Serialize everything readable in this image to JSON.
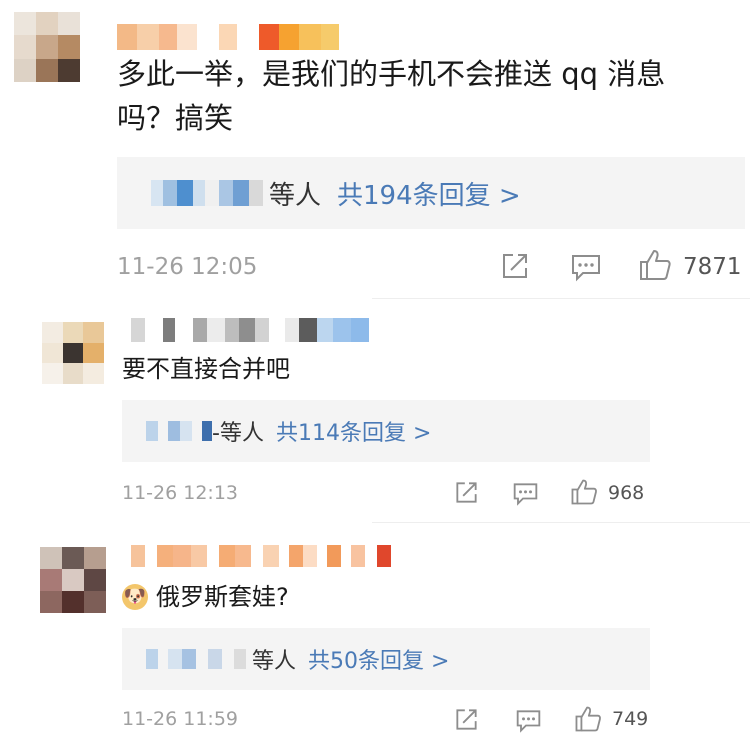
{
  "comments": [
    {
      "text_line1": "多此一举，是我们的手机不会推送 qq 消息",
      "text_line2": "吗？搞笑",
      "reply_names_suffix": "等人",
      "reply_link": "共194条回复 >",
      "time": "11-26 12:05",
      "likes": "7871"
    },
    {
      "text_line1": "要不直接合并吧",
      "reply_names_suffix": "-等人",
      "reply_link": "共114条回复 >",
      "time": "11-26 12:13",
      "likes": "968"
    },
    {
      "emoji": "🐶",
      "text_line1": "俄罗斯套娃?",
      "reply_names_suffix": "等人",
      "reply_link": "共50条回复 >",
      "time": "11-26 11:59",
      "likes": "749"
    }
  ],
  "icons": {
    "repost": "share-icon",
    "comment": "comment-icon",
    "like": "thumbs-up-icon"
  },
  "colors": {
    "link": "#4a7ab6",
    "meta": "#9b9b9b",
    "reply_bg": "#f4f4f4",
    "text": "#1a1a1a"
  }
}
